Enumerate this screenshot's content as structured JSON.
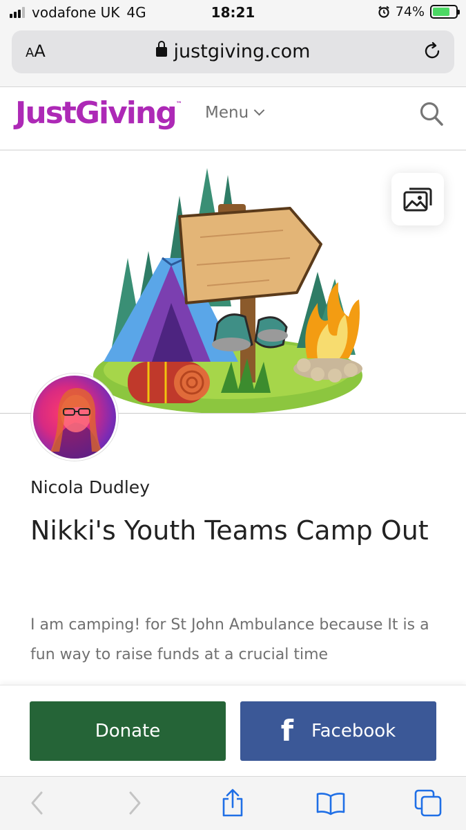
{
  "status_bar": {
    "carrier": "vodafone UK",
    "network": "4G",
    "time": "18:21",
    "battery_percent": "74%",
    "battery_level": 0.74,
    "alarm_icon": "alarm-clock-icon"
  },
  "browser": {
    "text_size_label_small": "A",
    "text_size_label_large": "A",
    "url": "justgiving.com",
    "lock_icon": "lock-icon",
    "reload_icon": "reload-icon"
  },
  "site_header": {
    "logo": "JustGiving",
    "logo_tm": "™",
    "menu_label": "Menu",
    "search_icon": "search-icon",
    "brand_color": "#ad29b6"
  },
  "hero": {
    "gallery_icon": "image-gallery-icon"
  },
  "page": {
    "owner_name": "Nicola Dudley",
    "title": "Nikki's Youth Teams Camp Out",
    "description": "I am camping! for St John Ambulance because It is a fun way to raise funds at a crucial time"
  },
  "actions": {
    "donate_label": "Donate",
    "donate_color": "#256437",
    "facebook_label": "Facebook",
    "facebook_icon": "f",
    "facebook_color": "#3b5897"
  },
  "toolbar": {
    "icons": [
      "back-icon",
      "forward-icon",
      "share-icon",
      "bookmarks-icon",
      "tabs-icon"
    ]
  }
}
